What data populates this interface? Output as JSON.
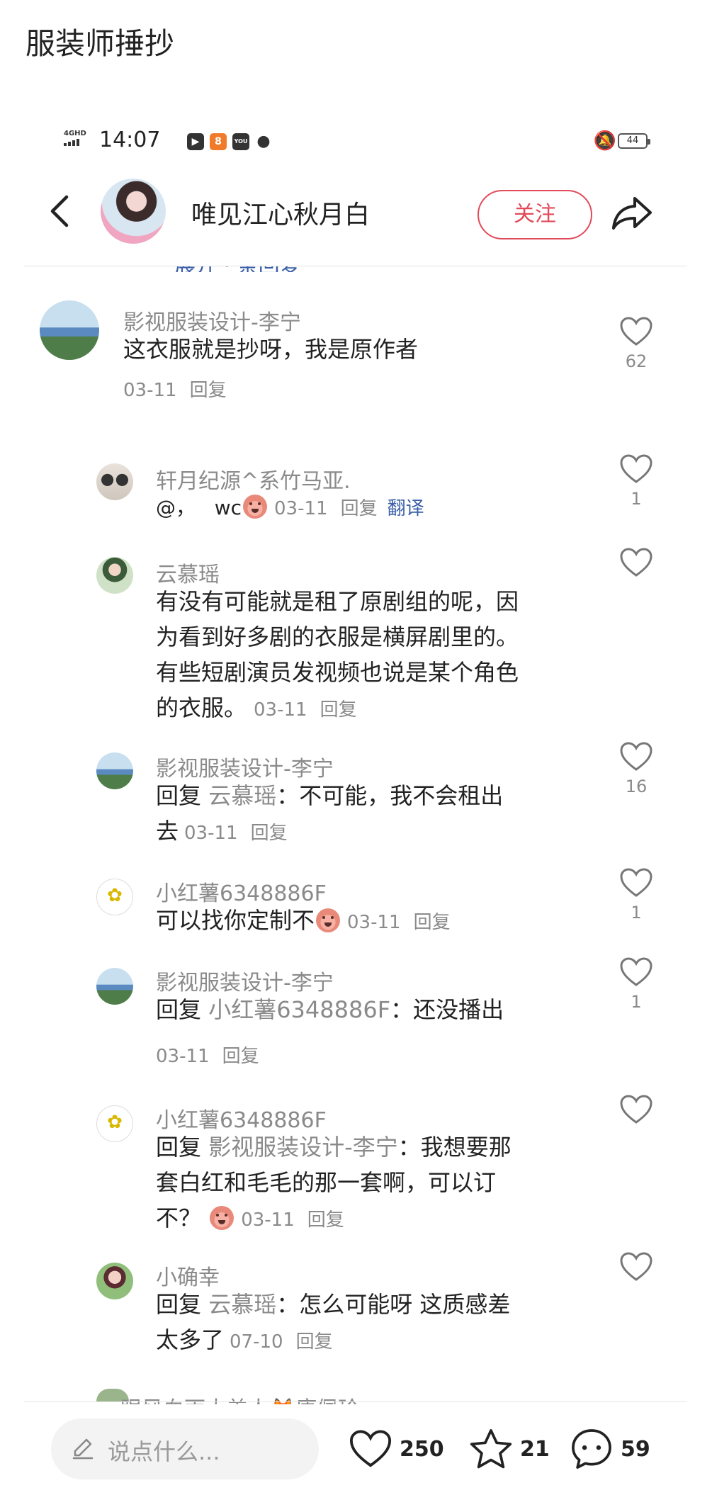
{
  "page_title": "服装师捶抄",
  "status_bar": {
    "network": "4GHD",
    "time": "14:07",
    "battery": "44",
    "app_icons": [
      "play-icon",
      "app-orange-icon",
      "youku-icon",
      "wechat-icon"
    ]
  },
  "post_header": {
    "author_name": "唯见江心秋月白",
    "follow_label": "关注"
  },
  "comments": [
    {
      "name": "影视服装设计-李宁",
      "text": "这衣服就是抄呀，我是原作者",
      "date": "03-11",
      "reply_label": "回复",
      "likes": "62"
    },
    {
      "name": "轩月纪源^系竹马亚.",
      "text_prefix": "@，",
      "text_suffix": "wc",
      "date": "03-11",
      "reply_label": "回复",
      "translate_label": "翻译",
      "likes": "1"
    },
    {
      "name": "云慕瑶",
      "text_lines": [
        "有没有可能就是租了原剧组的呢，因",
        "为看到好多剧的衣服是横屏剧里的。",
        "有些短剧演员发视频也说是某个角色",
        "的衣服。"
      ],
      "date": "03-11",
      "reply_label": "回复",
      "likes": ""
    },
    {
      "name": "影视服装设计-李宁",
      "reply_word": "回复",
      "mention": "云慕瑶",
      "text_line1": "：不可能，我不会租出",
      "text_line2": "去",
      "date": "03-11",
      "reply_label": "回复",
      "likes": "16"
    },
    {
      "name": "小红薯6348886F",
      "text": "可以找你定制不",
      "date": "03-11",
      "reply_label": "回复",
      "likes": "1"
    },
    {
      "name": "影视服装设计-李宁",
      "reply_word": "回复",
      "mention": "小红薯6348886F",
      "text": "：还没播出",
      "date": "03-11",
      "reply_label": "回复",
      "likes": "1"
    },
    {
      "name": "小红薯6348886F",
      "reply_word": "回复",
      "mention": "影视服装设计-李宁",
      "text_line1": "：我想要那",
      "text_line2": "套白红和毛毛的那一套啊，可以订",
      "text_line3": "不？",
      "date": "03-11",
      "reply_label": "回复",
      "likes": ""
    },
    {
      "name": "小确幸",
      "reply_word": "回复",
      "mention": "云慕瑶",
      "text_line1": "：怎么可能呀 这质感差",
      "text_line2": "太多了",
      "date": "07-10",
      "reply_label": "回复",
      "likes": ""
    }
  ],
  "peek_comment_name": "眼风血雨大美人🦊康佩玲",
  "bottom_bar": {
    "input_placeholder": "说点什么...",
    "like_count": "250",
    "star_count": "21",
    "comment_count": "59"
  },
  "colors": {
    "follow_red": "#e24a5a",
    "link_blue": "#3a5ea8",
    "muted_gray": "#8a8a8a"
  }
}
